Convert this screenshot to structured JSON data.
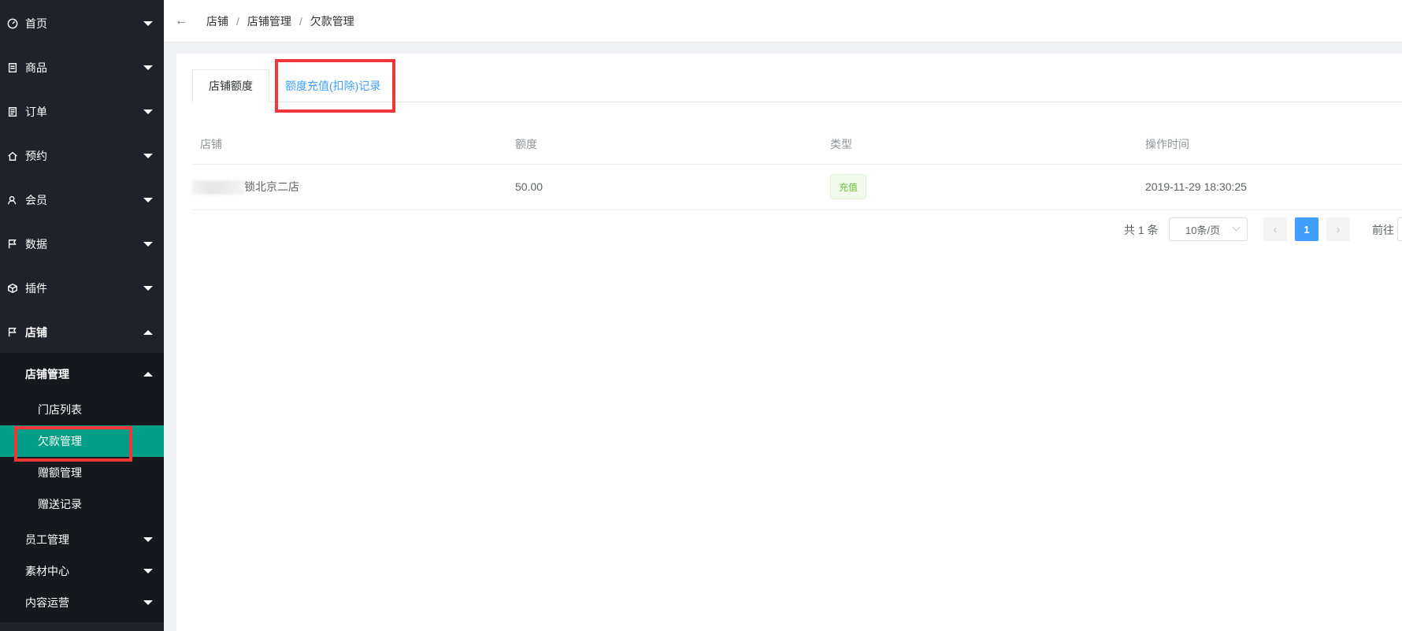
{
  "sidebar": {
    "menu": [
      {
        "label": "首页",
        "icon": "dashboard-icon"
      },
      {
        "label": "商品",
        "icon": "document-icon"
      },
      {
        "label": "订单",
        "icon": "clipboard-icon"
      },
      {
        "label": "预约",
        "icon": "home-icon"
      },
      {
        "label": "会员",
        "icon": "users-icon"
      },
      {
        "label": "数据",
        "icon": "flag-icon"
      },
      {
        "label": "插件",
        "icon": "cube-icon"
      },
      {
        "label": "店铺",
        "icon": "flag-icon"
      }
    ],
    "store_sub": {
      "label": "店铺管理",
      "items": [
        "门店列表",
        "欠款管理",
        "赠额管理",
        "赠送记录"
      ],
      "active": "欠款管理"
    },
    "other_subs": [
      "员工管理",
      "素材中心",
      "内容运营"
    ]
  },
  "breadcrumb": [
    "店铺",
    "店铺管理",
    "欠款管理"
  ],
  "tabs": [
    "店铺额度",
    "额度充值(扣除)记录"
  ],
  "table": {
    "headers": [
      "店铺",
      "额度",
      "类型",
      "操作时间"
    ],
    "rows": [
      {
        "store": "锁北京二店",
        "amount": "50.00",
        "type": "充值",
        "time": "2019-11-29 18:30:25"
      }
    ]
  },
  "pagination": {
    "total": "共 1 条",
    "page_size": "10条/页",
    "current": "1",
    "goto": "前往"
  },
  "colors": {
    "accent": "#409eff",
    "active_menu": "#009e86",
    "highlight": "#f2363a"
  }
}
